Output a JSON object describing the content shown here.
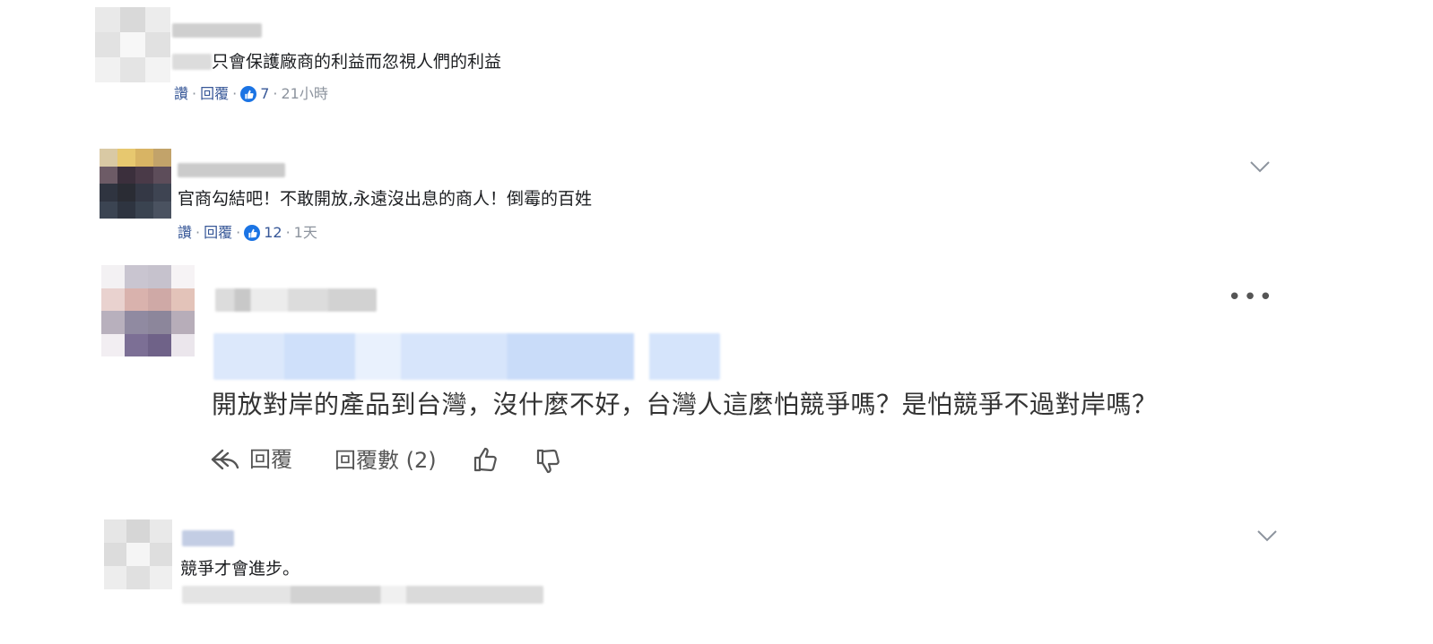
{
  "comments": [
    {
      "text": "只會保護廠商的利益而忽視人們的利益",
      "actions": {
        "like": "讚",
        "reply": "回覆",
        "separator": "·"
      },
      "reactions": "7",
      "time": "21小時"
    },
    {
      "text": "官商勾結吧！不敢開放,永遠沒出息的商人！倒霉的百姓",
      "actions": {
        "like": "讚",
        "reply": "回覆",
        "separator": "·"
      },
      "reactions": "12",
      "time": "1天"
    },
    {
      "text": "開放對岸的產品到台灣，沒什麼不好，台灣人這麼怕競爭嗎？是怕競爭不過對岸嗎？",
      "actions": {
        "reply": "回覆",
        "reply_count": "回覆數 (2)"
      },
      "menu": "•••"
    },
    {
      "text": "競爭才會進步。"
    }
  ],
  "icons": {
    "like_badge": "thumbs-up-icon",
    "collapse": "chevron-down-icon",
    "reply": "reply-arrow-icon",
    "upvote": "thumbs-up-outline-icon",
    "downvote": "thumbs-down-outline-icon",
    "more": "more-dots-icon"
  },
  "colors": {
    "link": "#385898",
    "like_blue": "#1b74e4",
    "muted": "#8d949e"
  }
}
